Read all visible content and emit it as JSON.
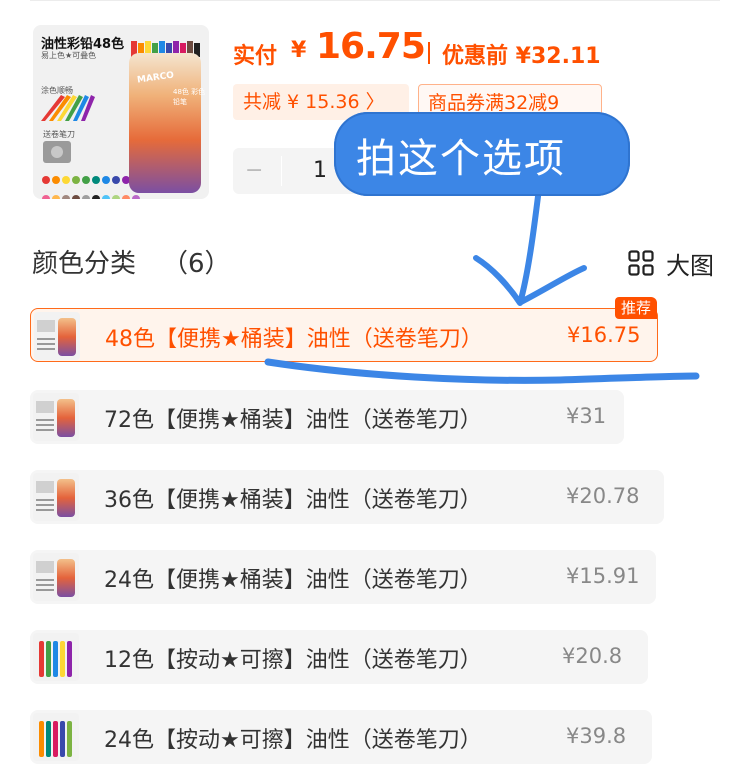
{
  "product": {
    "thumbnail": {
      "title": "油性彩铅48色",
      "subtitle": "易上色★可叠色",
      "detail": "涂色顺畅",
      "accessory": "送卷笔刀",
      "brand": "MARCO",
      "tube_text": "48色 彩色铅笔"
    },
    "price_label": "实付",
    "currency": "¥",
    "price": "16.75",
    "original_price": "优惠前 ¥32.11",
    "savings_chip": "共减 ¥ 15.36 〉",
    "coupon_chip": "商品券满32减9"
  },
  "quantity": {
    "minus": "−",
    "value": "1"
  },
  "section": {
    "title": "颜色分类",
    "count": "（6）",
    "bigview_label": "大图"
  },
  "options": [
    {
      "name": "48色【便携★桶装】油性（送卷笔刀）",
      "price": "¥16.75",
      "badge": "推荐",
      "selected": true
    },
    {
      "name": "72色【便携★桶装】油性（送卷笔刀）",
      "price": "¥31",
      "selected": false
    },
    {
      "name": "36色【便携★桶装】油性（送卷笔刀）",
      "price": "¥20.78",
      "selected": false
    },
    {
      "name": "24色【便携★桶装】油性（送卷笔刀）",
      "price": "¥15.91",
      "selected": false
    },
    {
      "name": "12色【按动★可擦】油性（送卷笔刀）",
      "price": "¥20.8",
      "selected": false
    },
    {
      "name": "24色【按动★可擦】油性（送卷笔刀）",
      "price": "¥39.8",
      "selected": false
    }
  ],
  "annotation": {
    "text": "拍这个选项",
    "color": "#3c86e6"
  },
  "colors": {
    "accent": "#ff5000",
    "selected_bg": "#fff4ec",
    "option_bg": "#f5f5f5"
  },
  "icons": {
    "grid": "grid-view-icon",
    "sharpener": "sharpener-icon"
  }
}
